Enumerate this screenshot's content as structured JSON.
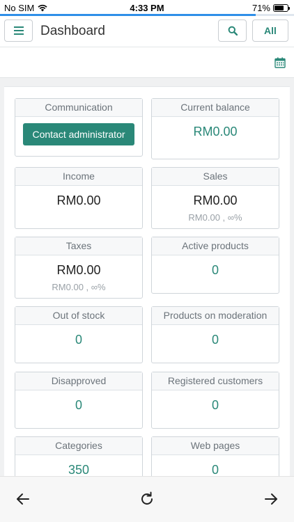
{
  "status_bar": {
    "carrier": "No SIM",
    "time": "4:33 PM",
    "battery": "71%",
    "battery_level": 0.71,
    "load_progress": 0.87
  },
  "header": {
    "title": "Dashboard",
    "filter_label": "All"
  },
  "icons": {
    "menu": "hamburger-menu-icon",
    "search": "search-icon",
    "calendar": "calendar-icon",
    "back": "arrow-left-icon",
    "reload": "reload-icon",
    "forward": "arrow-right-icon"
  },
  "colors": {
    "accent": "#2a8878",
    "progress": "#2f8fe8"
  },
  "cards": {
    "communication": {
      "title": "Communication",
      "button_label": "Contact administrator"
    },
    "current_balance": {
      "title": "Current balance",
      "value": "RM0.00"
    },
    "income": {
      "title": "Income",
      "value": "RM0.00"
    },
    "sales": {
      "title": "Sales",
      "value": "RM0.00",
      "sub": "RM0.00 , ∞%"
    },
    "taxes": {
      "title": "Taxes",
      "value": "RM0.00",
      "sub": "RM0.00 , ∞%"
    },
    "active_products": {
      "title": "Active products",
      "value": "0"
    },
    "out_of_stock": {
      "title": "Out of stock",
      "value": "0"
    },
    "products_on_moderation": {
      "title": "Products on moderation",
      "value": "0"
    },
    "disapproved": {
      "title": "Disapproved",
      "value": "0"
    },
    "registered_customers": {
      "title": "Registered customers",
      "value": "0"
    },
    "categories": {
      "title": "Categories",
      "value": "350"
    },
    "web_pages": {
      "title": "Web pages",
      "value": "0"
    }
  }
}
